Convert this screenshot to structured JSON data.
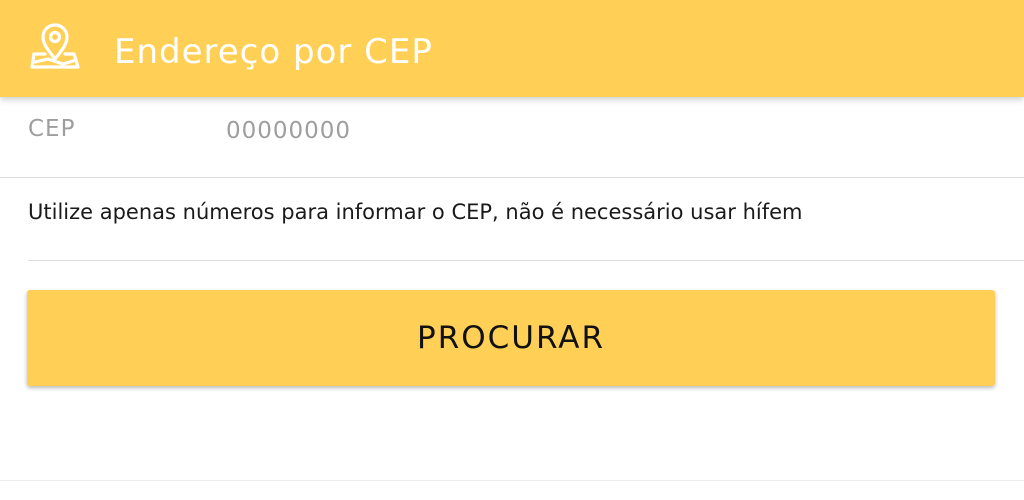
{
  "header": {
    "title": "Endereço por CEP",
    "icon": "map-pin-icon",
    "background_color": "#ffd055",
    "text_color": "#ffffff"
  },
  "form": {
    "cep_label": "CEP",
    "cep_placeholder": "00000000",
    "cep_value": "",
    "hint": "Utilize apenas números para informar o CEP, não é necessário usar hífem"
  },
  "actions": {
    "search_label": "PROCURAR",
    "button_color": "#ffd055"
  }
}
